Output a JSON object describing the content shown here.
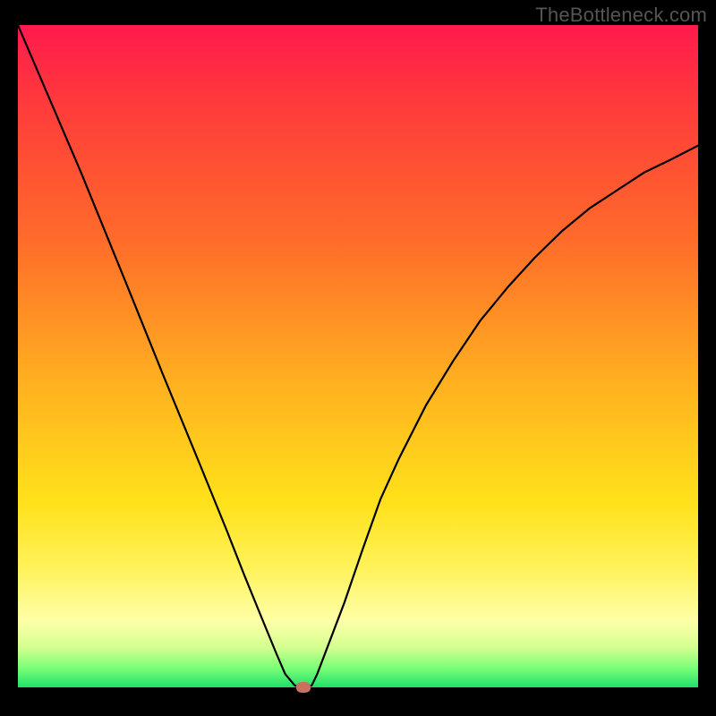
{
  "watermark": "TheBottleneck.com",
  "chart_data": {
    "type": "line",
    "title": "",
    "xlabel": "",
    "ylabel": "",
    "xlim": [
      0,
      1
    ],
    "ylim": [
      0,
      1
    ],
    "gradient_stops": [
      {
        "pos": 0.0,
        "color": "#ff1a4d"
      },
      {
        "pos": 0.12,
        "color": "#ff3b3b"
      },
      {
        "pos": 0.32,
        "color": "#ff6a2a"
      },
      {
        "pos": 0.55,
        "color": "#ffb31f"
      },
      {
        "pos": 0.72,
        "color": "#ffe11a"
      },
      {
        "pos": 0.82,
        "color": "#fff25a"
      },
      {
        "pos": 0.9,
        "color": "#feffa8"
      },
      {
        "pos": 0.94,
        "color": "#d3ff8f"
      },
      {
        "pos": 0.97,
        "color": "#7dff78"
      },
      {
        "pos": 1.0,
        "color": "#1fe06a"
      }
    ],
    "series": [
      {
        "name": "curve",
        "x": [
          0.0,
          0.093,
          0.16,
          0.213,
          0.267,
          0.307,
          0.333,
          0.36,
          0.38,
          0.393,
          0.407,
          0.417,
          0.423,
          0.432,
          0.44,
          0.48,
          0.507,
          0.533,
          0.56,
          0.6,
          0.64,
          0.68,
          0.72,
          0.76,
          0.8,
          0.84,
          0.88,
          0.92,
          0.96,
          1.0
        ],
        "y": [
          1.0,
          0.777,
          0.608,
          0.473,
          0.338,
          0.237,
          0.169,
          0.101,
          0.051,
          0.02,
          0.003,
          0.0,
          0.0,
          0.003,
          0.02,
          0.128,
          0.209,
          0.284,
          0.345,
          0.426,
          0.493,
          0.554,
          0.604,
          0.649,
          0.689,
          0.723,
          0.75,
          0.777,
          0.797,
          0.818
        ]
      }
    ],
    "marker": {
      "x": 0.42,
      "y": 0.0,
      "color": "#c97060"
    },
    "minimum_value_x": 0.42
  }
}
